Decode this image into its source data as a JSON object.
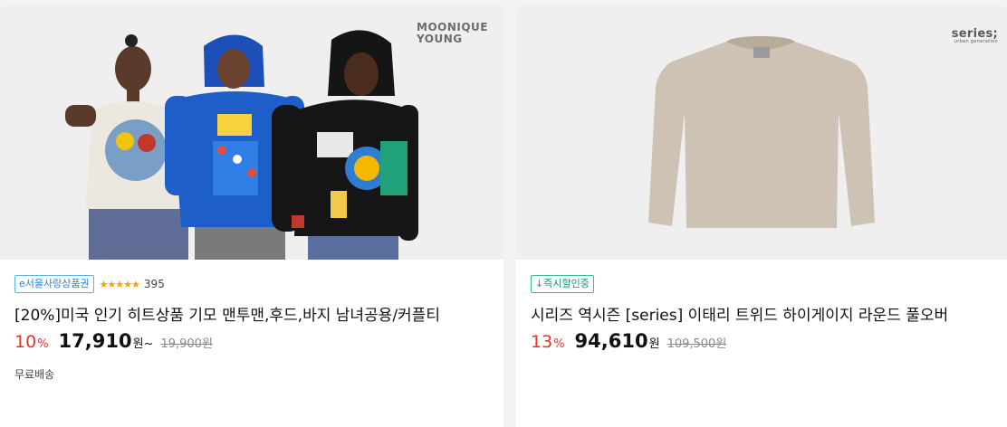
{
  "products": [
    {
      "brand_logo": "MOONIQUE YOUNG",
      "tag_label": "e서울사랑상품권",
      "rating_stars": "★★★★★",
      "review_count": "395",
      "title": "[20%]미국 인기 히트상품 기모 맨투맨,후드,바지 남녀공용/커플티",
      "discount_rate": "10",
      "discount_unit": "%",
      "price": "17,910",
      "price_unit": "원~",
      "original_price": "19,900원",
      "shipping": "무료배송"
    },
    {
      "brand_logo": "series;",
      "brand_sub": "urban generation",
      "tag_label": "↓즉시할인중",
      "title": "시리즈 역시즌 [series] 이태리 트위드 하이게이지 라운드 풀오버",
      "discount_rate": "13",
      "discount_unit": "%",
      "price": "94,610",
      "price_unit": "원",
      "original_price": "109,500원"
    }
  ],
  "colors": {
    "discount": "#e5322d",
    "tag_border": "#3ab7a0",
    "star": "#f2a100"
  }
}
